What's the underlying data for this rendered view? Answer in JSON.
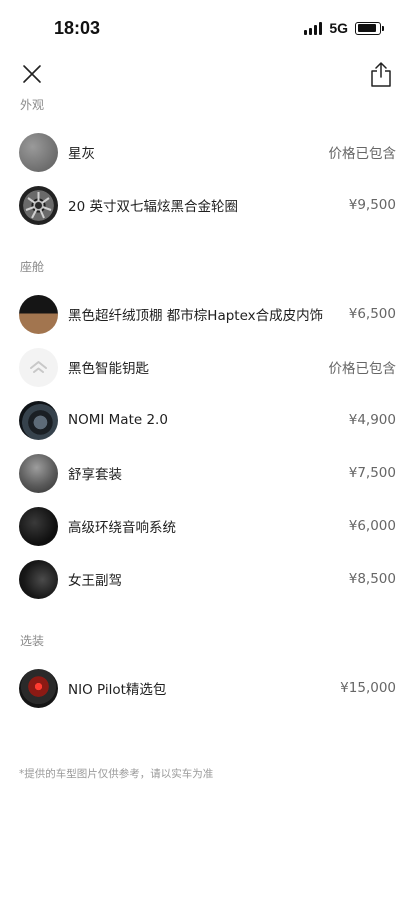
{
  "status_bar": {
    "time": "18:03",
    "network": "5G"
  },
  "sections": {
    "exterior": "外观",
    "cabin": "座舱",
    "options": "选装"
  },
  "items": [
    {
      "name": "星灰",
      "price": "价格已包含",
      "icon": "star-gray-paint-swatch"
    },
    {
      "name": "20 英寸双七辐炫黑合金轮圈",
      "price": "¥9,500",
      "icon": "wheel-rim-thumbnail"
    },
    {
      "name": "黑色超纤绒顶棚 都市棕Haptex合成皮内饰",
      "price": "¥6,500",
      "icon": "interior-swatch"
    },
    {
      "name": "黑色智能钥匙",
      "price": "价格已包含",
      "icon": "smart-key-thumbnail"
    },
    {
      "name": "NOMI Mate 2.0",
      "price": "¥4,900",
      "icon": "nomi-thumbnail"
    },
    {
      "name": "舒享套装",
      "price": "¥7,500",
      "icon": "seat-package-thumbnail"
    },
    {
      "name": "高级环绕音响系统",
      "price": "¥6,000",
      "icon": "audio-system-thumbnail"
    },
    {
      "name": "女王副驾",
      "price": "¥8,500",
      "icon": "queen-seat-thumbnail"
    },
    {
      "name": "NIO Pilot精选包",
      "price": "¥15,000",
      "icon": "nio-pilot-thumbnail"
    }
  ],
  "footnote": "*提供的车型图片仅供参考，请以实车为准",
  "colors": {
    "text": "#1f1f1f",
    "secondary": "#8a8a8a",
    "price": "#666666",
    "background": "#ffffff"
  }
}
